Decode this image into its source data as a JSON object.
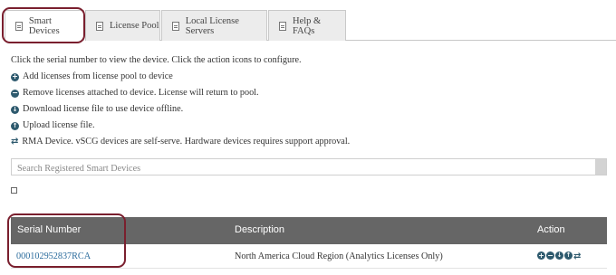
{
  "tabs": [
    {
      "label": "Smart Devices",
      "active": true
    },
    {
      "label": "License Pool",
      "active": false
    },
    {
      "label": "Local License Servers",
      "active": false
    },
    {
      "label": "Help & FAQs",
      "active": false
    }
  ],
  "instructions": {
    "intro": "Click the serial number to view the device. Click the action icons to configure.",
    "add": "Add licenses from license pool to device",
    "remove": "Remove licenses attached to device. License will return to pool.",
    "download": "Download license file to use device offline.",
    "upload": "Upload license file.",
    "rma": "RMA Device. vSCG devices are self-serve. Hardware devices requires support approval."
  },
  "search": {
    "placeholder": "Search Registered Smart Devices"
  },
  "table": {
    "headers": {
      "serial": "Serial Number",
      "description": "Description",
      "action": "Action"
    },
    "rows": [
      {
        "serial": "000102952837RCA",
        "description": "North America Cloud Region (Analytics Licenses Only)"
      }
    ]
  },
  "colors": {
    "accent": "#2e5a6e",
    "link": "#2a6b9c",
    "highlight": "#7a1f2e",
    "header_bg": "#666666"
  },
  "icons": [
    "document-icon",
    "add-circle-icon",
    "remove-circle-icon",
    "download-circle-icon",
    "upload-circle-icon",
    "rma-refresh-icon"
  ]
}
